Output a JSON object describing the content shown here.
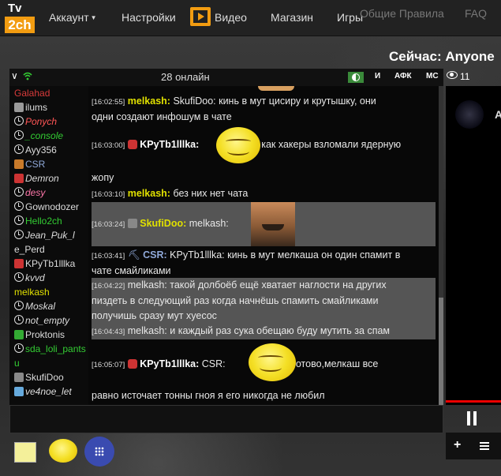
{
  "nav": {
    "logo_top": "Tv",
    "logo_bottom": "2ch",
    "account": "Аккаунт",
    "settings": "Настройки",
    "video": "Видео",
    "shop": "Магазин",
    "games": "Игры",
    "rules": "Общие Правила",
    "faq": "FAQ"
  },
  "now_playing": "Сейчас: Anyone",
  "chat_header": {
    "online": "28 онлайн",
    "btn_i": "И",
    "btn_afk": "АФК",
    "btn_mc": "МС",
    "viewers": "11"
  },
  "users": [
    {
      "name": "Galahad",
      "color": "#d83a3a",
      "icon": "none"
    },
    {
      "name": "ilums",
      "color": "#dddddd",
      "icon": "hourglass"
    },
    {
      "name": "Ponych",
      "color": "#ff5555",
      "icon": "clock"
    },
    {
      "name": "_console",
      "color": "#33cc33",
      "icon": "clock"
    },
    {
      "name": "Ayy356",
      "color": "#dddddd",
      "icon": "clock"
    },
    {
      "name": "CSR",
      "color": "#8fa8d8",
      "icon": "hat"
    },
    {
      "name": "Demron",
      "color": "#dddddd",
      "icon": "knife"
    },
    {
      "name": "desy",
      "color": "#ff77aa",
      "icon": "clock"
    },
    {
      "name": "Gownodozer",
      "color": "#dddddd",
      "icon": "clock"
    },
    {
      "name": "Hello2ch",
      "color": "#33cc33",
      "icon": "clock"
    },
    {
      "name": "Jean_Puk_l",
      "color": "#dddddd",
      "icon": "clock"
    },
    {
      "name": "e_Perd",
      "color": "#dddddd",
      "icon": "none"
    },
    {
      "name": "KPyTb1lllka",
      "color": "#dddddd",
      "icon": "red-avatar"
    },
    {
      "name": "kvvd",
      "color": "#dddddd",
      "icon": "clock"
    },
    {
      "name": "melkash",
      "color": "#e0e000",
      "icon": "none"
    },
    {
      "name": "Moskal",
      "color": "#dddddd",
      "icon": "clock"
    },
    {
      "name": "not_empty",
      "color": "#dddddd",
      "icon": "clock"
    },
    {
      "name": "Proktonis",
      "color": "#dddddd",
      "icon": "green-avatar"
    },
    {
      "name": "sda_loli_pants",
      "color": "#33cc33",
      "icon": "clock"
    },
    {
      "name": "u",
      "color": "#33cc33",
      "icon": "none"
    },
    {
      "name": "SkufiDoo",
      "color": "#dddddd",
      "icon": "avatar"
    },
    {
      "name": "ve4noe_let",
      "color": "#dddddd",
      "icon": "cloud"
    }
  ],
  "messages": [
    {
      "time": "[16:02:55]",
      "nick": "melkash:",
      "text": "SkufiDoo: кинь в мут цисиру и крутышку, они",
      "text2": "одни создают инфошум в чате"
    },
    {
      "time": "[16:03:00]",
      "nick": "KPyTb1lllka:",
      "text": "как хакеры взломали ядерную",
      "text2": "жопу"
    },
    {
      "time": "[16:03:10]",
      "nick": "melkash:",
      "text": "без них нет чата"
    },
    {
      "time": "[16:03:24]",
      "nick": "SkufiDoo:",
      "text": "melkash:"
    },
    {
      "time": "[16:03:41]",
      "nick": "CSR:",
      "text": "KPyTb1lllka: кинь в мут мелкаша он один спамит в",
      "text2": "чате смайликами"
    },
    {
      "time": "[16:04:22]",
      "nick": "melkash:",
      "text": "такой долбоёб ещё хватает наглости на других",
      "text2": "пиздеть в следующий раз когда начнёшь спамить смайликами",
      "text3": "получишь сразу мут хуесос"
    },
    {
      "time": "[16:04:43]",
      "nick": "melkash:",
      "text": "и каждый раз сука обещаю буду мутить за спам"
    },
    {
      "time": "[16:05:07]",
      "nick": "KPyTb1lllka:",
      "text": "CSR:",
      "text_after": "готово,мелкаш все",
      "text2": "равно источает тонны гноя я его никогда не любил"
    }
  ],
  "video": {
    "letter": "A"
  }
}
